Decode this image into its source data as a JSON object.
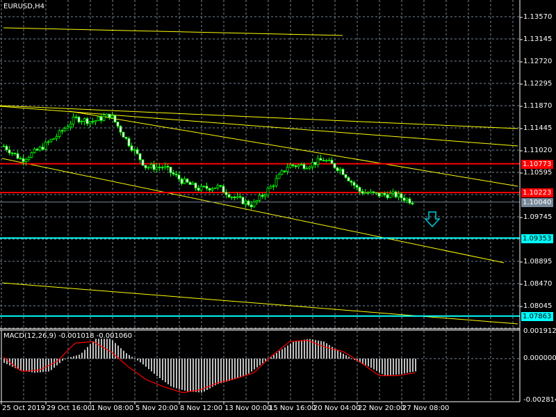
{
  "chart": {
    "symbol_title": "EURUSD,H4",
    "price_axis": [
      "1.13570",
      "1.13145",
      "1.12720",
      "1.12295",
      "1.11870",
      "1.11445",
      "1.11020",
      "1.10595",
      "1.09745",
      "1.08895",
      "1.08470",
      "1.08045"
    ],
    "levels": [
      {
        "label": "1.10773",
        "price": 1.10773,
        "color": "#ff0000"
      },
      {
        "label": "1.10223",
        "price": 1.10223,
        "color": "#ff0000"
      },
      {
        "label": "1.09353",
        "price": 1.09353,
        "color": "#00ffff"
      },
      {
        "label": "1.07863",
        "price": 1.07863,
        "color": "#00ffff"
      }
    ],
    "current_price": {
      "label": "1.10040",
      "price": 1.1004,
      "color": "#778899"
    },
    "date_axis": [
      "25 Oct 2019",
      "29 Oct 16:00",
      "1 Nov 08:00",
      "5 Nov 20:00",
      "8 Nov 12:00",
      "13 Nov 00:00",
      "15 Nov 16:00",
      "20 Nov 04:00",
      "22 Nov 20:00",
      "27 Nov 08:00"
    ],
    "close_waypoints": [
      1.1111,
      1.1085,
      1.1105,
      1.1131,
      1.1164,
      1.1158,
      1.1171,
      1.1118,
      1.1071,
      1.1071,
      1.1045,
      1.1029,
      1.1034,
      1.1012,
      1.0998,
      1.1032,
      1.1074,
      1.1074,
      1.1085,
      1.1065,
      1.1025,
      1.1018,
      1.1018,
      1.1005
    ],
    "bull_color": "#00ff00",
    "line_color": "#ffff00",
    "signal_arrow": "down-arrow-icon"
  },
  "macd": {
    "title": "MACD(12,26,9) -0.001018 -0.001060",
    "axis": [
      "0.001912",
      "0.000000",
      "-0.002814"
    ],
    "range": [
      -0.002814,
      0.001912
    ],
    "histogram_waypoints": [
      -0.0003,
      -0.0008,
      -0.001,
      -0.0009,
      0,
      0.0003,
      0.0014,
      0.0014,
      0.0004,
      -0.0003,
      -0.0012,
      -0.002,
      -0.0023,
      -0.0024,
      -0.0018,
      -0.0015,
      -0.0011,
      -0.0003,
      0.0005,
      0.0012,
      0.0014,
      0.0012,
      0.0005,
      -0.0001,
      -0.0006,
      -0.0012,
      -0.0011,
      -0.0009
    ],
    "signal_waypoints": [
      0.0001,
      -0.0009,
      -0.0008,
      -0.0002,
      0.0011,
      0.0012,
      0.0005,
      -0.0006,
      -0.0015,
      -0.002,
      -0.0024,
      -0.0022,
      -0.0017,
      -0.0014,
      -0.001,
      0.0002,
      0.0012,
      0.0013,
      0.0008,
      0.0005,
      -0.0003,
      -0.0012,
      -0.0012,
      -0.001
    ],
    "histogram_color": "#c0c0c0",
    "signal_color": "#ff0000"
  }
}
